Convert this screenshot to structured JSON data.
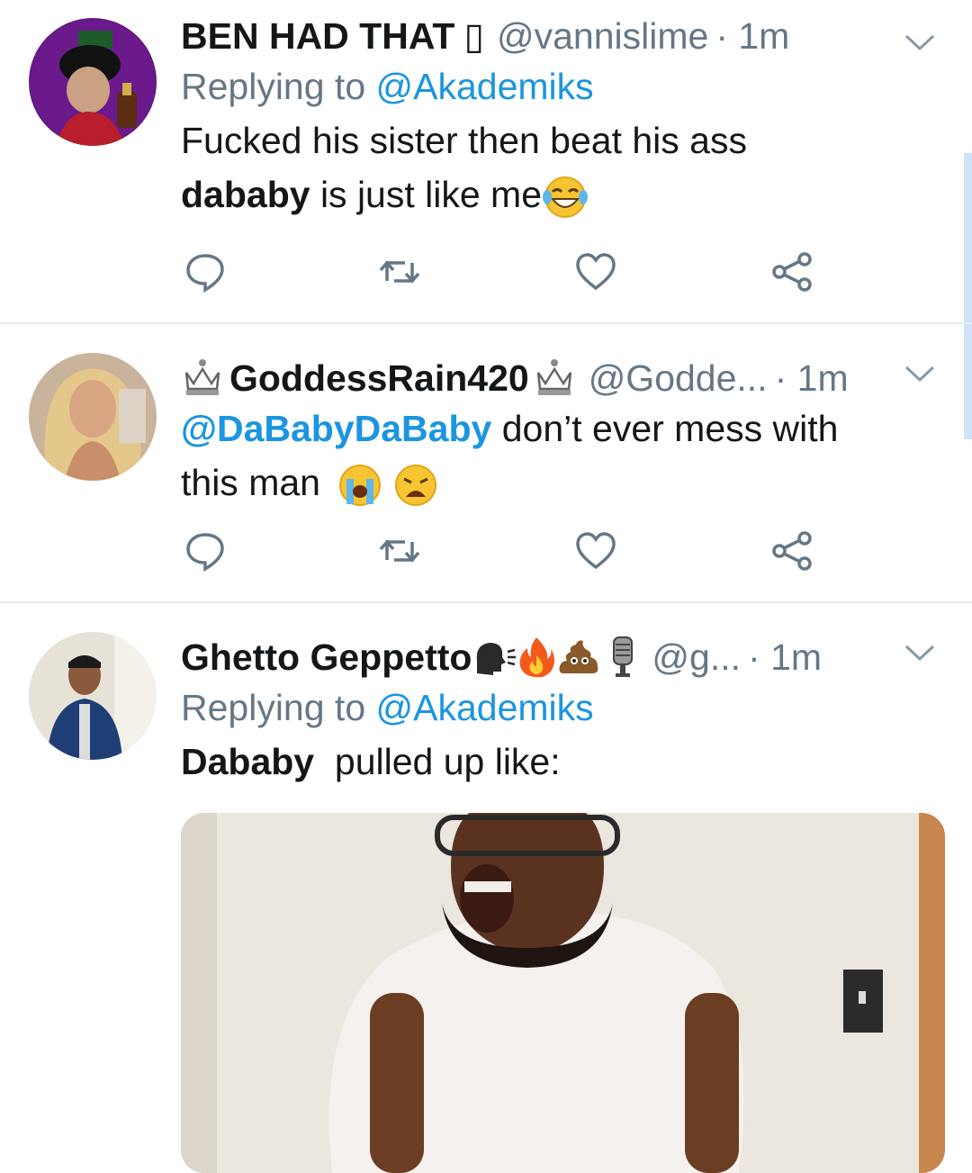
{
  "tweets": [
    {
      "name": "BEN HAD THAT",
      "name_suffix": "▯",
      "handle": "@vannislime",
      "time": "· 1m",
      "reply_prefix": "Replying to",
      "reply_to": "@Akademiks",
      "text_line1": "Fucked his sister then beat his ass",
      "text_bold": "dababy",
      "text_rest": " is just like me"
    },
    {
      "name": "GoddessRain420",
      "handle": "@Godde...",
      "time": "· 1m",
      "mention": "@DaBabyDaBaby",
      "text_rest": " don’t ever mess with",
      "text_line2": "this man"
    },
    {
      "name": "Ghetto Geppetto",
      "handle": "@g...",
      "time": "· 1m",
      "reply_prefix": "Replying to",
      "reply_to": "@Akademiks",
      "text_bold": "Dababy",
      "text_rest": "  pulled up like:"
    }
  ],
  "colors": {
    "text": "#14171a",
    "secondary": "#657786",
    "link": "#1b95e0",
    "divider": "#e6ecf0"
  },
  "icons": [
    "reply-icon",
    "retweet-icon",
    "like-icon",
    "share-icon",
    "chevron-down-icon",
    "crown-icon"
  ]
}
